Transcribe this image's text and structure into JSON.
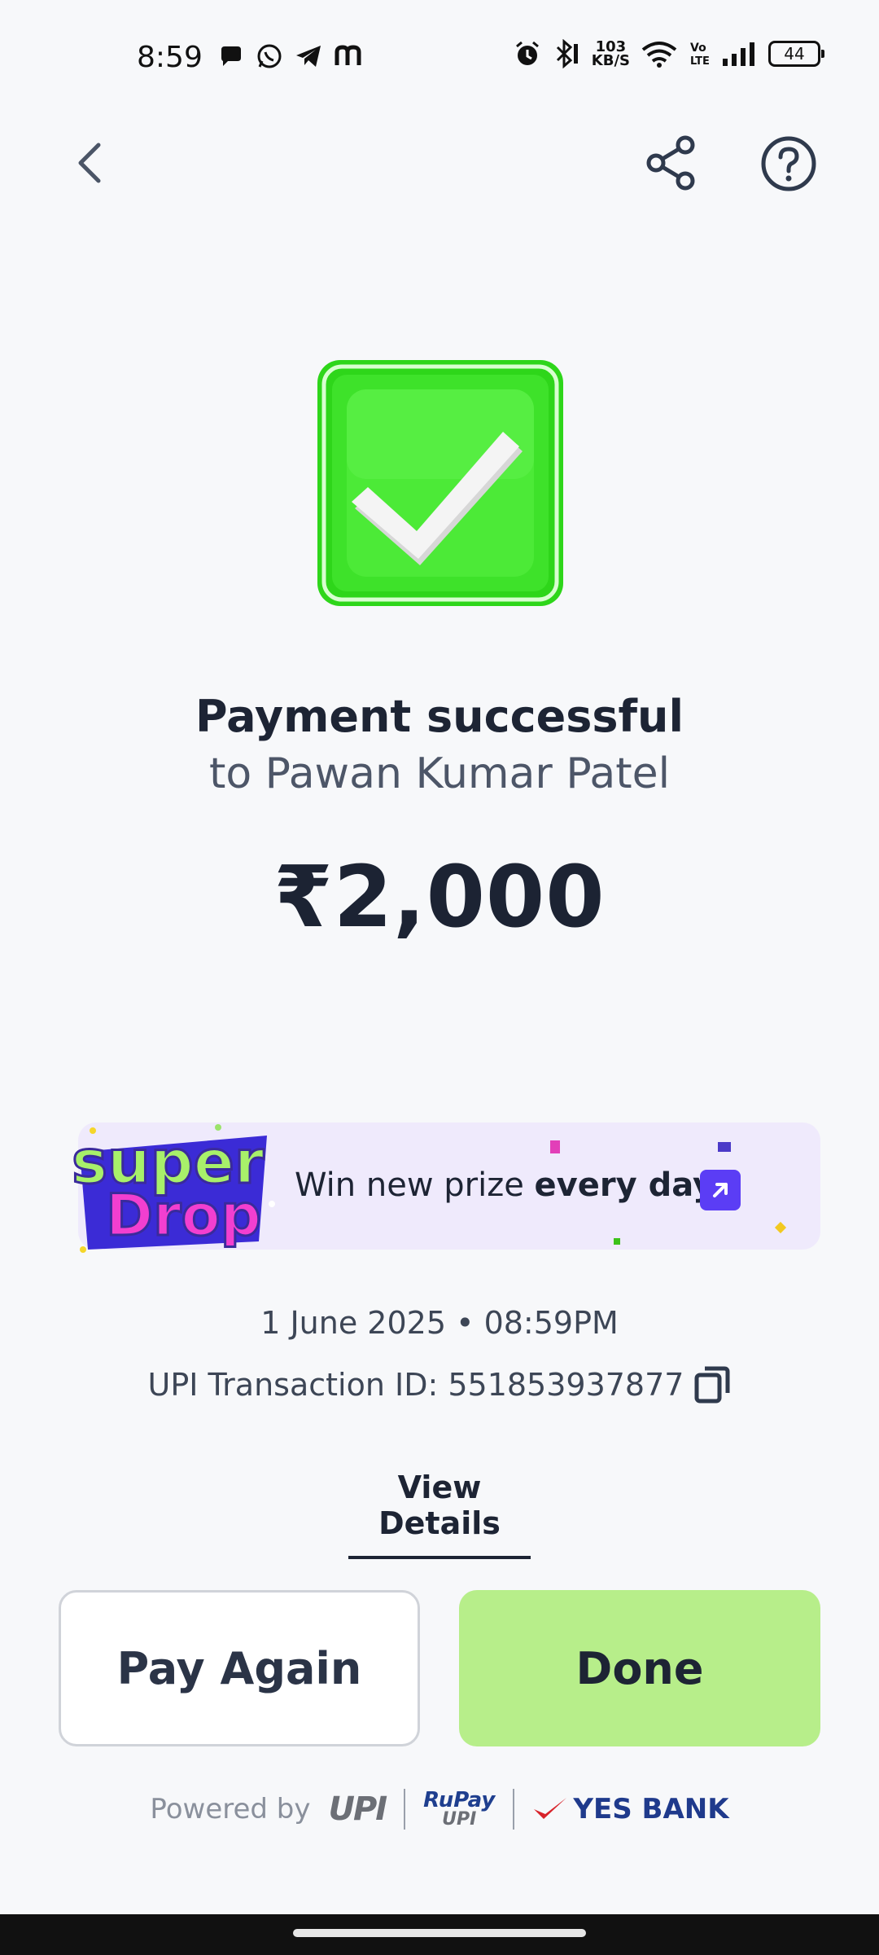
{
  "status_bar": {
    "time": "8:59",
    "network_speed_value": "103",
    "network_speed_unit": "KB/S",
    "volte": "Vo LTE",
    "battery": "44"
  },
  "header": {
    "back_icon": "chevron-left-icon",
    "share_icon": "share-icon",
    "help_icon": "help-circle-icon"
  },
  "payment": {
    "status": "Payment successful",
    "recipient": "to Pawan Kumar Patel",
    "amount": "₹2,000"
  },
  "banner": {
    "logo_line1": "super",
    "logo_line2": "Drop",
    "text_prefix": "Win new prize ",
    "text_bold": "every day!"
  },
  "transaction": {
    "date": "1 June 2025 • 08:59PM",
    "upi_id_label": "UPI Transaction ID: 551853937877"
  },
  "actions": {
    "view_details": "View Details",
    "pay_again": "Pay Again",
    "done": "Done"
  },
  "footer": {
    "powered_by": "Powered by",
    "upi": "UPI",
    "rupay": "RuPay",
    "rupay_upi": "UPI",
    "bank": "YES BANK"
  },
  "colors": {
    "success_green": "#3fdc2a",
    "done_button": "#b7ee8a",
    "accent_purple": "#5b3df5"
  }
}
